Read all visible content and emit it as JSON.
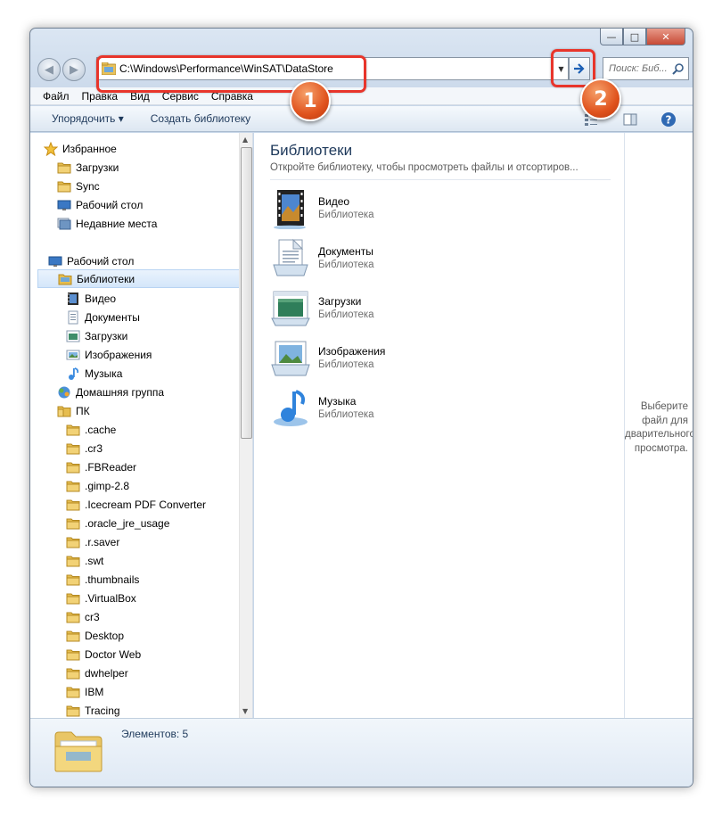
{
  "address_bar": {
    "path": "C:\\Windows\\Performance\\WinSAT\\DataStore"
  },
  "search": {
    "placeholder": "Поиск: Биб..."
  },
  "menu": [
    "Файл",
    "Правка",
    "Вид",
    "Сервис",
    "Справка"
  ],
  "toolbar": {
    "organize_label": "Упорядочить ▾",
    "new_library_label": "Создать библиотеку"
  },
  "window_controls": {
    "minimize": "—",
    "maximize": "□",
    "close": "✕"
  },
  "nav_tree": [
    {
      "label": "Избранное",
      "icon": "star-icon"
    },
    {
      "label": "Загрузки",
      "icon": "folder-icon"
    },
    {
      "label": "Sync",
      "icon": "folder-icon"
    },
    {
      "label": "Рабочий стол",
      "icon": "desktop-icon"
    },
    {
      "label": "Недавние места",
      "icon": "recent-places-icon"
    },
    {
      "label": "Рабочий стол",
      "icon": "desktop-icon"
    },
    {
      "label": "Библиотеки",
      "icon": "libraries-icon"
    },
    {
      "label": "Видео",
      "icon": "video-library-icon"
    },
    {
      "label": "Документы",
      "icon": "documents-library-icon"
    },
    {
      "label": "Загрузки",
      "icon": "downloads-library-icon"
    },
    {
      "label": "Изображения",
      "icon": "pictures-library-icon"
    },
    {
      "label": "Музыка",
      "icon": "music-library-icon"
    },
    {
      "label": "Домашняя группа",
      "icon": "homegroup-icon"
    },
    {
      "label": "ПК",
      "icon": "computer-folder-icon"
    },
    {
      "label": ".cache",
      "icon": "folder-icon"
    },
    {
      "label": ".cr3",
      "icon": "folder-icon"
    },
    {
      "label": ".FBReader",
      "icon": "folder-icon"
    },
    {
      "label": ".gimp-2.8",
      "icon": "folder-icon"
    },
    {
      "label": ".Icecream PDF Converter",
      "icon": "folder-icon"
    },
    {
      "label": ".oracle_jre_usage",
      "icon": "folder-icon"
    },
    {
      "label": ".r.saver",
      "icon": "folder-icon"
    },
    {
      "label": ".swt",
      "icon": "folder-icon"
    },
    {
      "label": ".thumbnails",
      "icon": "folder-icon"
    },
    {
      "label": ".VirtualBox",
      "icon": "folder-icon"
    },
    {
      "label": "cr3",
      "icon": "folder-icon"
    },
    {
      "label": "Desktop",
      "icon": "folder-icon"
    },
    {
      "label": "Doctor Web",
      "icon": "folder-icon"
    },
    {
      "label": "dwhelper",
      "icon": "folder-icon"
    },
    {
      "label": "IBM",
      "icon": "folder-icon"
    },
    {
      "label": "Tracing",
      "icon": "folder-icon"
    }
  ],
  "main": {
    "title": "Библиотеки",
    "subtitle": "Откройте библиотеку, чтобы просмотреть файлы и отсортиров...",
    "libraries": [
      {
        "name": "Видео",
        "type": "Библиотека",
        "icon": "video-library-icon"
      },
      {
        "name": "Документы",
        "type": "Библиотека",
        "icon": "documents-library-icon"
      },
      {
        "name": "Загрузки",
        "type": "Библиотека",
        "icon": "downloads-library-icon"
      },
      {
        "name": "Изображения",
        "type": "Библиотека",
        "icon": "pictures-library-icon"
      },
      {
        "name": "Музыка",
        "type": "Библиотека",
        "icon": "music-library-icon"
      }
    ]
  },
  "preview": {
    "message": "Выберите файл для дварительного просмотра."
  },
  "details": {
    "count_label": "Элементов: 5"
  },
  "annotations": {
    "badge1": "1",
    "badge2": "2",
    "highlight_color": "#e8352b",
    "badge_color": "#e0531e"
  },
  "colors": {
    "selected_bg": "#d4e6fa",
    "title_blue": "#1e395b"
  }
}
